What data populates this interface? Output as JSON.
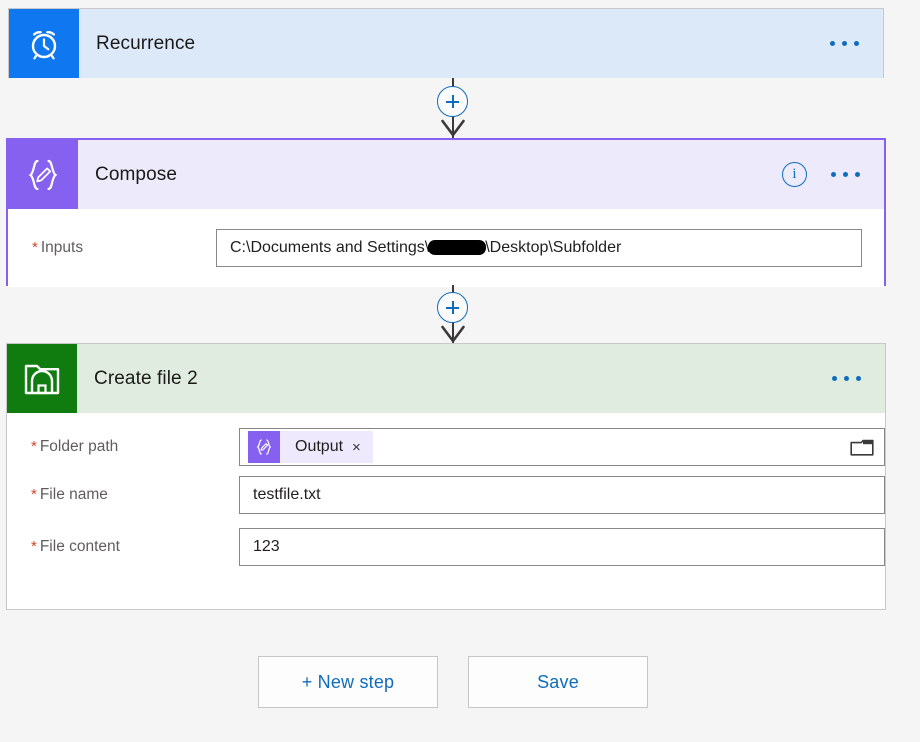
{
  "flow": {
    "steps": [
      {
        "id": "recurrence",
        "title": "Recurrence",
        "icon": "alarm-clock-icon",
        "icon_bg": "#0f78f0",
        "header_bg": "#dce9f9",
        "selected": false,
        "has_info": false,
        "menu_label": "...",
        "fields": []
      },
      {
        "id": "compose",
        "title": "Compose",
        "icon": "compose-braces-pencil-icon",
        "icon_bg": "#8661ef",
        "header_bg": "#edeafb",
        "selected": true,
        "has_info": true,
        "menu_label": "...",
        "fields": [
          {
            "label": "Inputs",
            "required": true,
            "value_prefix": "C:\\Documents and Settings\\",
            "value_suffix": "\\Desktop\\Subfolder",
            "redacted": true
          }
        ]
      },
      {
        "id": "create-file-2",
        "title": "Create file 2",
        "icon": "file-system-folder-icon",
        "icon_bg": "#107c10",
        "header_bg": "#dfecdf",
        "selected": false,
        "has_info": false,
        "menu_label": "...",
        "fields": [
          {
            "label": "Folder path",
            "required": true,
            "token": {
              "label": "Output",
              "icon": "compose-braces-pencil-icon",
              "remove_label": "×"
            },
            "picker_icon": "folder-picker-icon",
            "value": ""
          },
          {
            "label": "File name",
            "required": true,
            "value": "testfile.txt"
          },
          {
            "label": "File content",
            "required": true,
            "value": "123"
          }
        ]
      }
    ],
    "connectors": [
      {
        "add_label": "+"
      },
      {
        "add_label": "+"
      }
    ]
  },
  "actions": {
    "new_step": "+ New step",
    "save": "Save"
  },
  "colors": {
    "accent_blue": "#0f6cbd",
    "recurrence_blue": "#0f78f0",
    "compose_purple": "#8661ef",
    "file_green": "#107c10",
    "required_red": "#d24726",
    "canvas_bg": "#f5f5f5"
  }
}
